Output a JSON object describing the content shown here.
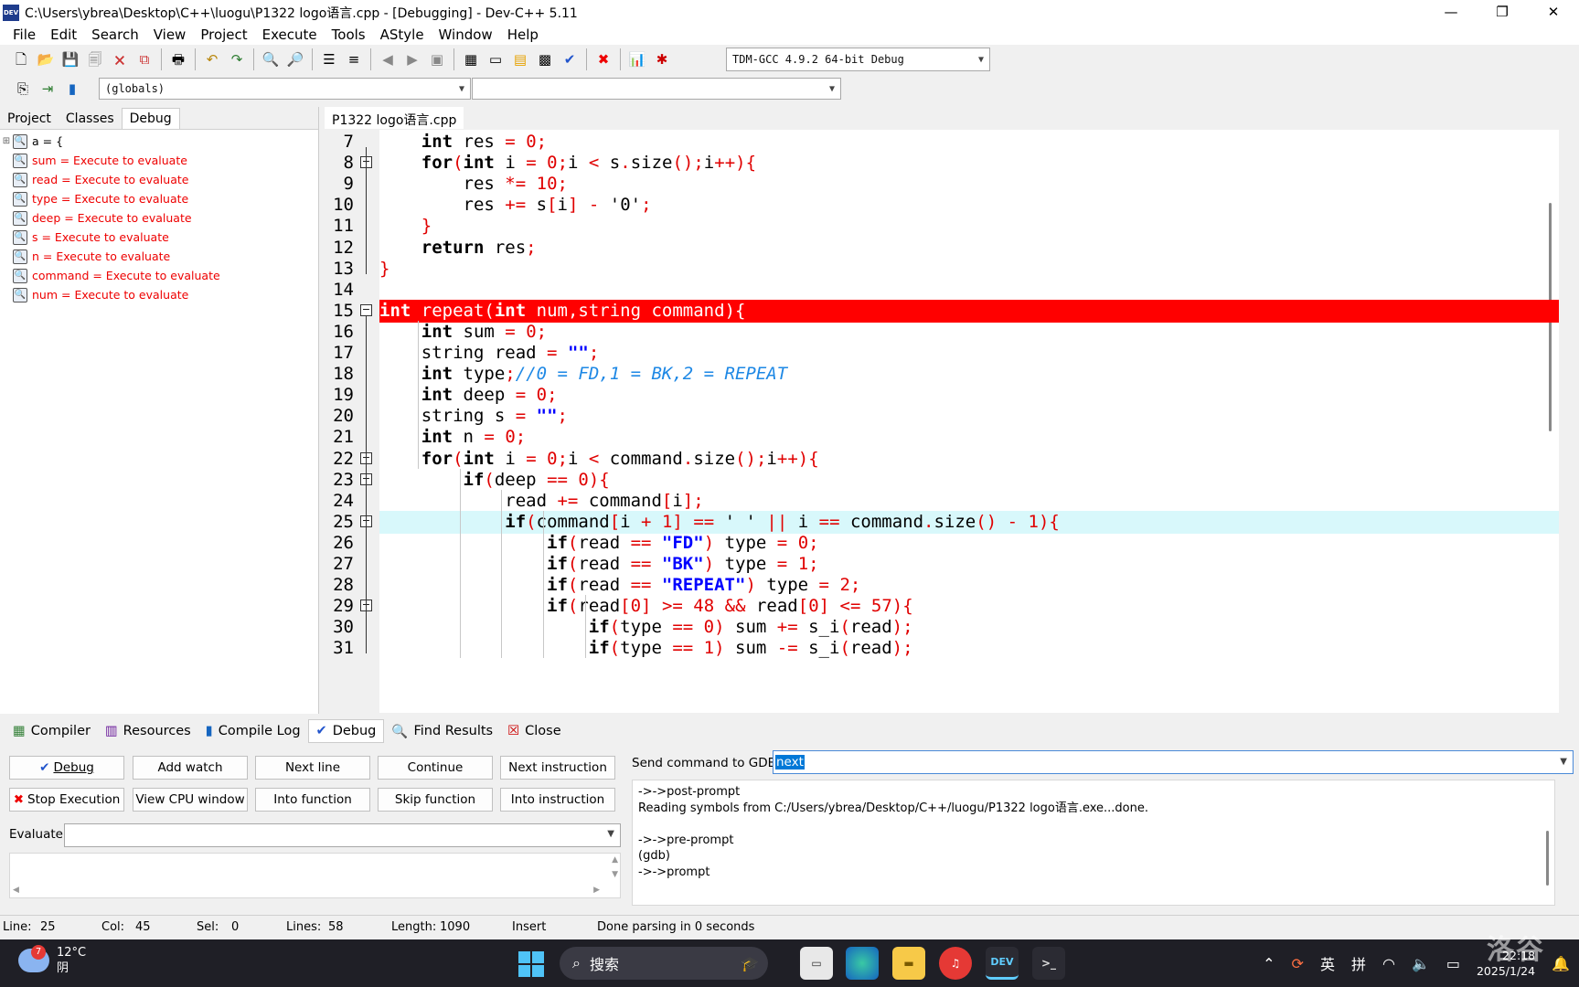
{
  "window": {
    "title": "C:\\Users\\ybrea\\Desktop\\C++\\luogu\\P1322 logo语言.cpp - [Debugging] - Dev-C++ 5.11",
    "app_icon": "DEV",
    "min": "—",
    "max": "❐",
    "close": "✕"
  },
  "menu": [
    "File",
    "Edit",
    "Search",
    "View",
    "Project",
    "Execute",
    "Tools",
    "AStyle",
    "Window",
    "Help"
  ],
  "toolbar": {
    "compiler": "TDM-GCC 4.9.2 64-bit Debug",
    "scope": "(globals)",
    "symbol": ""
  },
  "left_panel": {
    "tabs": [
      "Project",
      "Classes",
      "Debug"
    ],
    "watches": [
      "a = {",
      "sum = Execute to evaluate",
      "read = Execute to evaluate",
      "type = Execute to evaluate",
      "deep = Execute to evaluate",
      "s = Execute to evaluate",
      "n = Execute to evaluate",
      "command = Execute to evaluate",
      "num = Execute to evaluate"
    ]
  },
  "editor": {
    "tab": "P1322 logo语言.cpp",
    "line_numbers": [
      "7",
      "8",
      "9",
      "10",
      "11",
      "12",
      "13",
      "14",
      "15",
      "16",
      "17",
      "18",
      "19",
      "20",
      "21",
      "22",
      "23",
      "24",
      "25",
      "26",
      "27",
      "28",
      "29",
      "30",
      "31"
    ],
    "breakpoint_line": "15",
    "current_line": "25"
  },
  "bottom_tabs": [
    "Compiler",
    "Resources",
    "Compile Log",
    "Debug",
    "Find Results",
    "Close"
  ],
  "debug": {
    "buttons": {
      "debug": "Debug",
      "add_watch": "Add watch",
      "next_line": "Next line",
      "continue": "Continue",
      "next_instruction": "Next instruction",
      "stop": "Stop Execution",
      "cpu": "View CPU window",
      "into_function": "Into function",
      "skip_function": "Skip function",
      "into_instruction": "Into instruction"
    },
    "evaluate_label": "Evaluate:",
    "evaluate_value": "",
    "gdb_label": "Send command to GDB:",
    "gdb_value": "next",
    "gdb_output": [
      "->->post-prompt",
      "Reading symbols from C:/Users/ybrea/Desktop/C++/luogu/P1322 logo语言.exe...done.",
      "",
      "->->pre-prompt",
      "(gdb)",
      "->->prompt"
    ]
  },
  "status": {
    "line_label": "Line:",
    "line": "25",
    "col_label": "Col:",
    "col": "45",
    "sel_label": "Sel:",
    "sel": "0",
    "lines_label": "Lines:",
    "lines": "58",
    "length_label": "Length:",
    "length": "1090",
    "mode": "Insert",
    "message": "Done parsing in 0 seconds"
  },
  "taskbar": {
    "temp": "12°C",
    "weather": "阴",
    "badge": "7",
    "search": "搜索",
    "ime1": "英",
    "ime2": "拼",
    "time": "22:18",
    "date": "2025/1/24",
    "watermark": "洛谷",
    "dev_label": "DEV"
  }
}
